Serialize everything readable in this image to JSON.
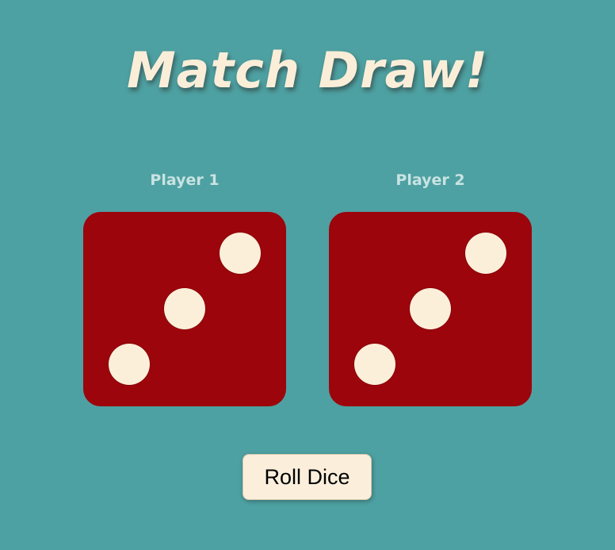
{
  "title": "Match Draw!",
  "players": [
    {
      "label": "Player 1",
      "die_value": 3
    },
    {
      "label": "Player 2",
      "die_value": 3
    }
  ],
  "roll_button": {
    "label": "Roll Dice"
  },
  "colors": {
    "background": "#4ea1a2",
    "title": "#fbeed9",
    "player_label": "#c9e3e2",
    "die_face": "#9c050c",
    "pip": "#fbefd9",
    "button_bg": "#fbefdc"
  }
}
